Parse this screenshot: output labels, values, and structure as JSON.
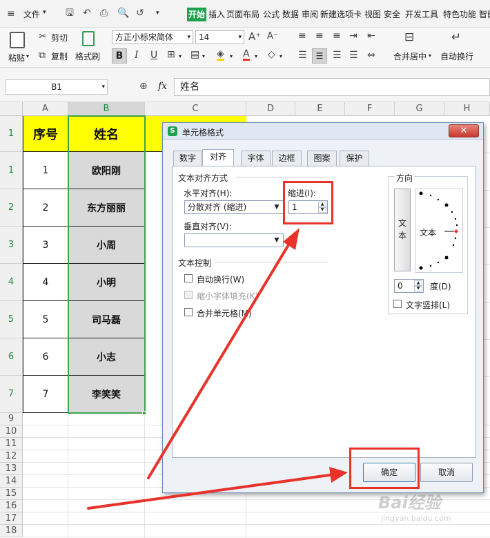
{
  "menubar": {
    "file_label": "文件",
    "tabs": [
      "开始",
      "插入",
      "页面布局",
      "公式",
      "数据",
      "审阅",
      "新建选项卡",
      "视图",
      "安全",
      "开发工具",
      "特色功能",
      "智能"
    ],
    "active_tab": "开始"
  },
  "ribbon": {
    "paste_label": "粘贴",
    "cut_label": "剪切",
    "copy_label": "复制",
    "format_painter_label": "格式刷",
    "font_name": "方正小标宋简体",
    "font_size": "14",
    "merge_center_label": "合并居中",
    "wrap_text_label": "自动换行"
  },
  "formula_bar": {
    "name_box": "B1",
    "fx_label": "fx",
    "content": "姓名"
  },
  "sheet": {
    "columns": [
      "A",
      "B",
      "C",
      "D",
      "E",
      "F",
      "G",
      "H"
    ],
    "header_row": {
      "seq": "序号",
      "name": "姓名"
    },
    "rows": [
      {
        "num": "1",
        "seq": "1",
        "name": "欧阳刚"
      },
      {
        "num": "2",
        "seq": "2",
        "name": "东方丽丽"
      },
      {
        "num": "3",
        "seq": "3",
        "name": "小周"
      },
      {
        "num": "4",
        "seq": "4",
        "name": "小明"
      },
      {
        "num": "5",
        "seq": "5",
        "name": "司马磊"
      },
      {
        "num": "6",
        "seq": "6",
        "name": "小志"
      },
      {
        "num": "7",
        "seq": "7",
        "name": "李笑笑"
      }
    ],
    "empty_rows": [
      "9",
      "10",
      "11",
      "12",
      "13",
      "14",
      "15",
      "16",
      "17",
      "18"
    ]
  },
  "dialog": {
    "title": "单元格格式",
    "tabs": [
      "数字",
      "对齐",
      "字体",
      "边框",
      "图案",
      "保护"
    ],
    "active_tab": "对齐",
    "text_alignment_section": "文本对齐方式",
    "horizontal_label": "水平对齐(H):",
    "horizontal_value": "分散对齐 (缩进)",
    "indent_label": "缩进(I):",
    "indent_value": "1",
    "vertical_label": "垂直对齐(V):",
    "vertical_value": "",
    "text_control_section": "文本控制",
    "wrap_text_label": "自动换行(W)",
    "shrink_to_fit_label": "缩小字体填充(K)",
    "merge_cells_label": "合并单元格(M)",
    "orientation_section": "方向",
    "vertical_text_button": "文本",
    "orientation_text": "文本",
    "degrees_value": "0",
    "degrees_label": "度(D)",
    "vertical_text_label": "文字竖排(L)",
    "ok_label": "确定",
    "cancel_label": "取消"
  },
  "watermark": {
    "text": "Bai经验",
    "subtext": "jingyan.baidu.com"
  },
  "colors": {
    "accent": "#1fa04e",
    "header_fill": "#ffff00",
    "annotation": "#e8322a"
  }
}
